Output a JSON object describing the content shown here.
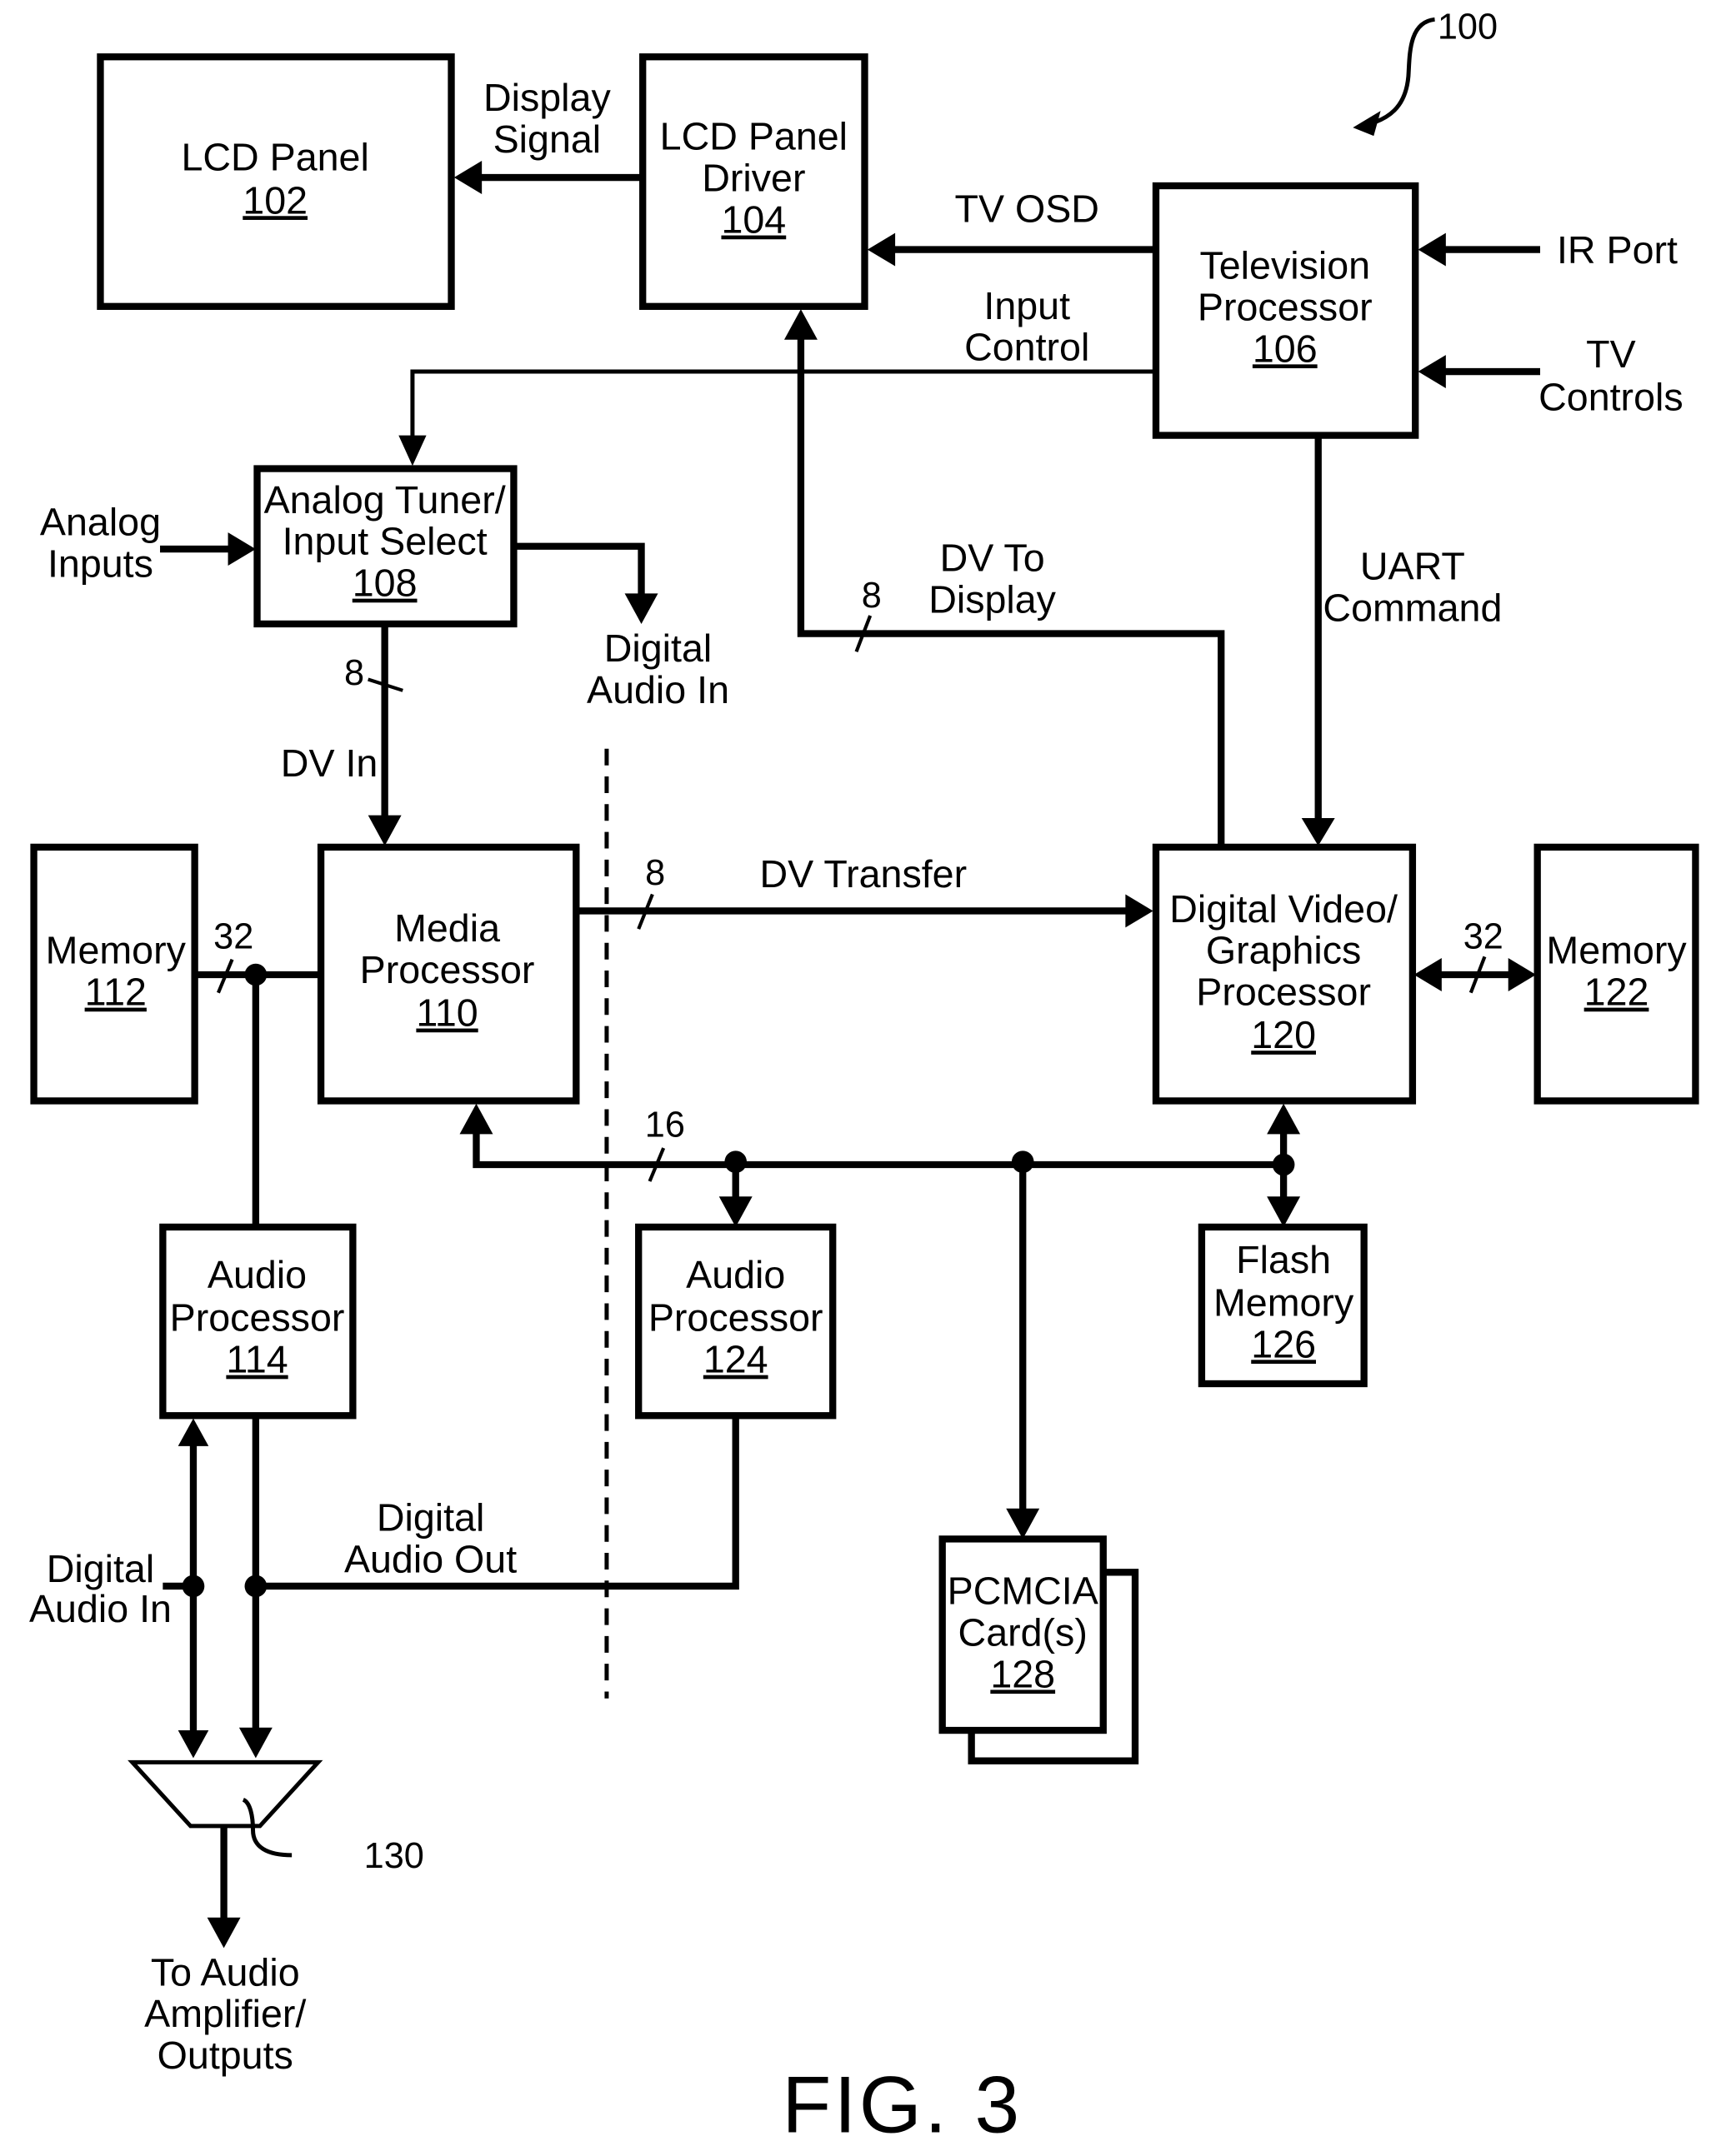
{
  "figure": {
    "title": "FIG. 3",
    "system_ref": "100"
  },
  "blocks": {
    "lcd_panel": {
      "lines": [
        "LCD Panel"
      ],
      "ref": "102"
    },
    "lcd_driver": {
      "lines": [
        "LCD Panel",
        "Driver"
      ],
      "ref": "104"
    },
    "tv_processor": {
      "lines": [
        "Television",
        "Processor"
      ],
      "ref": "106"
    },
    "analog_tuner": {
      "lines": [
        "Analog Tuner/",
        "Input Select"
      ],
      "ref": "108"
    },
    "media_processor": {
      "lines": [
        "Media",
        "Processor"
      ],
      "ref": "110"
    },
    "memory_112": {
      "lines": [
        "Memory"
      ],
      "ref": "112"
    },
    "audio_proc_114": {
      "lines": [
        "Audio",
        "Processor"
      ],
      "ref": "114"
    },
    "dv_graphics": {
      "lines": [
        "Digital Video/",
        "Graphics",
        "Processor"
      ],
      "ref": "120"
    },
    "memory_122": {
      "lines": [
        "Memory"
      ],
      "ref": "122"
    },
    "audio_proc_124": {
      "lines": [
        "Audio",
        "Processor"
      ],
      "ref": "124"
    },
    "flash_memory": {
      "lines": [
        "Flash",
        "Memory"
      ],
      "ref": "126"
    },
    "pcmcia": {
      "lines": [
        "PCMCIA",
        "Card(s)"
      ],
      "ref": "128"
    },
    "mixer_ref": "130"
  },
  "signals": {
    "display_signal": [
      "Display",
      "Signal"
    ],
    "tv_osd": "TV OSD",
    "input_control": [
      "Input",
      "Control"
    ],
    "ir_port": "IR Port",
    "tv_controls": [
      "TV",
      "Controls"
    ],
    "analog_inputs": [
      "Analog",
      "Inputs"
    ],
    "digital_audio_in_top": [
      "Digital",
      "Audio In"
    ],
    "dv_in": "DV In",
    "dv_to_display": [
      "DV To",
      "Display"
    ],
    "uart_command": [
      "UART",
      "Command"
    ],
    "dv_transfer": "DV Transfer",
    "digital_audio_out": [
      "Digital",
      "Audio Out"
    ],
    "digital_audio_in_bottom": [
      "Digital",
      "Audio In"
    ],
    "to_audio_amp": [
      "To Audio",
      "Amplifier/",
      "Outputs"
    ]
  },
  "bus_widths": {
    "dv_in": "8",
    "dv_to_display": "8",
    "dv_transfer": "8",
    "mem_112": "32",
    "mem_122": "32",
    "bus_16": "16"
  }
}
